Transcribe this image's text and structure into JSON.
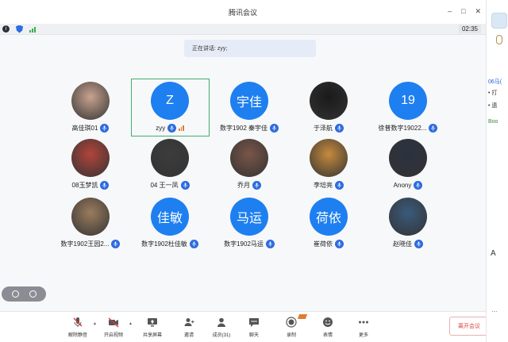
{
  "window": {
    "title": "腾讯会议",
    "clock": "02:35"
  },
  "speaking_banner": "正在讲话: zyy;",
  "participants": [
    {
      "name": "高佳琪01",
      "avatar_text": "",
      "avatar_kind": "photo",
      "photo_color": "#c9a38f"
    },
    {
      "name": "zyy",
      "avatar_text": "Z",
      "avatar_kind": "blue",
      "selected": true
    },
    {
      "name": "数字1902  秦宇佳",
      "avatar_text": "宇佳",
      "avatar_kind": "blue"
    },
    {
      "name": "于泽航",
      "avatar_text": "",
      "avatar_kind": "photo",
      "photo_color": "#1a1a1a"
    },
    {
      "name": "徐普数字19022...",
      "avatar_text": "19",
      "avatar_kind": "blue"
    },
    {
      "name": "08玉梦凯",
      "avatar_text": "",
      "avatar_kind": "photo",
      "photo_color": "#b2443a"
    },
    {
      "name": "04 王一凤",
      "avatar_text": "",
      "avatar_kind": "photo",
      "photo_color": "#3c3c3c"
    },
    {
      "name": "乔月",
      "avatar_text": "",
      "avatar_kind": "photo",
      "photo_color": "#7a5548"
    },
    {
      "name": "李培亮",
      "avatar_text": "",
      "avatar_kind": "photo",
      "photo_color": "#c68a3c"
    },
    {
      "name": "Anony",
      "avatar_text": "",
      "avatar_kind": "photo",
      "photo_color": "#2b3140"
    },
    {
      "name": "数字1902王园2...",
      "avatar_text": "",
      "avatar_kind": "photo",
      "photo_color": "#9b7c5e"
    },
    {
      "name": "数字1902杜佳敏",
      "avatar_text": "佳敏",
      "avatar_kind": "blue"
    },
    {
      "name": "数字1902马运",
      "avatar_text": "马运",
      "avatar_kind": "blue"
    },
    {
      "name": "崔荷依",
      "avatar_text": "荷依",
      "avatar_kind": "blue"
    },
    {
      "name": "赵晓佳",
      "avatar_text": "",
      "avatar_kind": "photo",
      "photo_color": "#3a5b7c"
    }
  ],
  "toolbar": {
    "mute": "解除静音",
    "video": "开启视频",
    "share": "共享屏幕",
    "invite": "邀请",
    "members": "成员(31)",
    "chat": "聊天",
    "record": "录制",
    "reactions": "表情",
    "more": "更多",
    "leave": "离开会议"
  },
  "side_panel": {
    "line1": "06马(",
    "line2": "• 打",
    "line3": "• 遗",
    "line4": "Boo",
    "font_button": "A"
  }
}
